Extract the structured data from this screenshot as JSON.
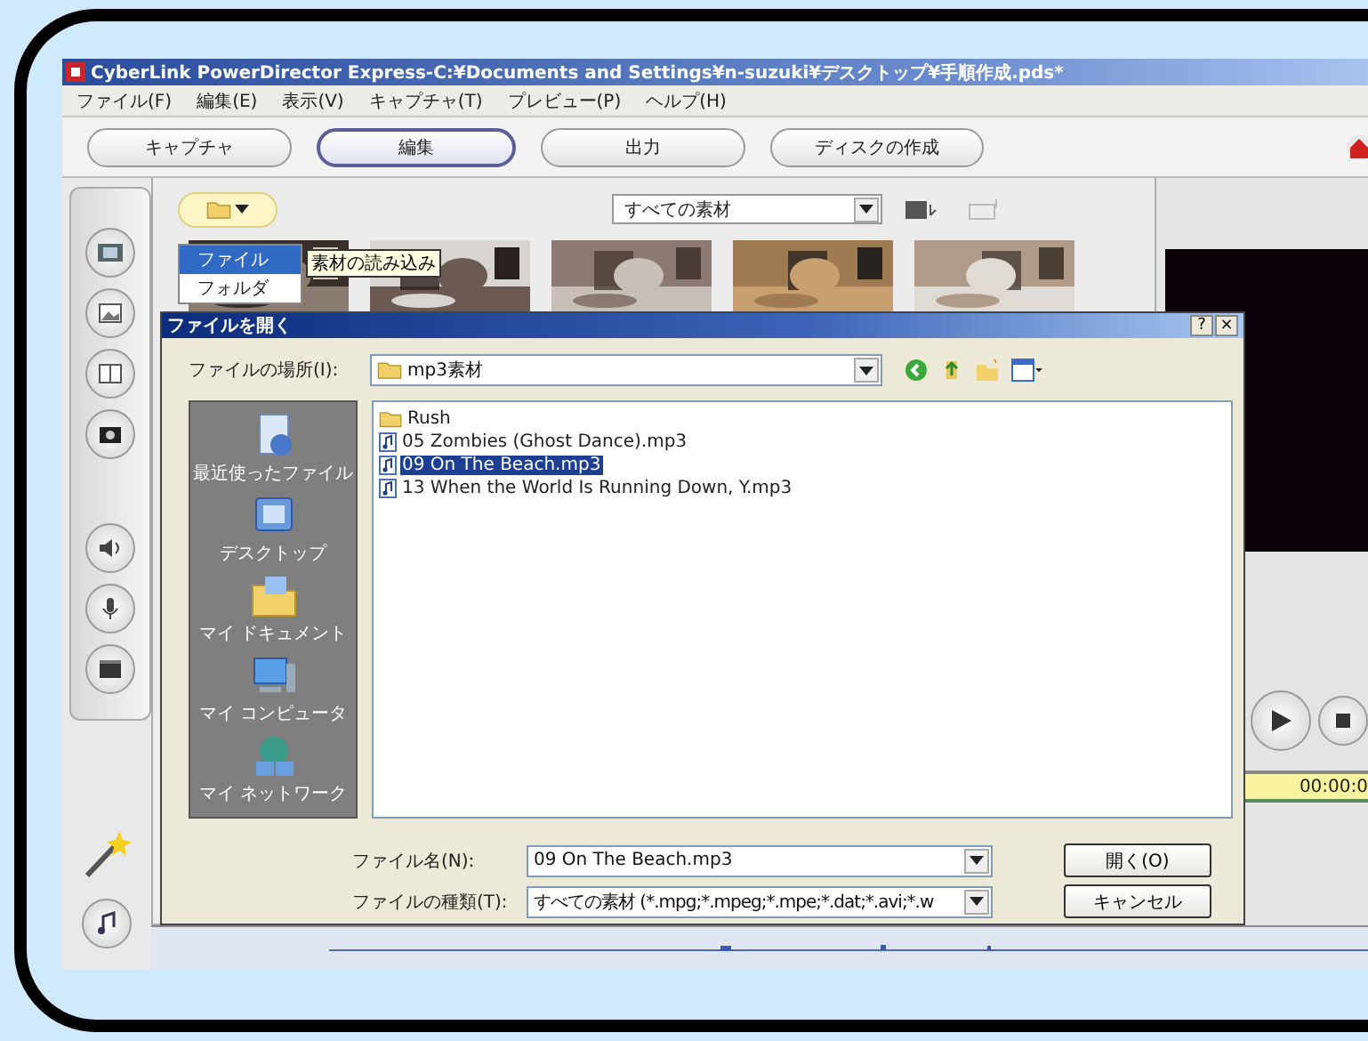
{
  "window": {
    "title": "CyberLink PowerDirector Express-C:¥Documents and Settings¥n-suzuki¥デスクトップ¥手順作成.pds*"
  },
  "menu": [
    "ファイル(F)",
    "編集(E)",
    "表示(V)",
    "キャプチャ(T)",
    "プレビュー(P)",
    "ヘルプ(H)"
  ],
  "mode_tabs": [
    {
      "label": "キャプチャ",
      "selected": false
    },
    {
      "label": "編集",
      "selected": true
    },
    {
      "label": "出力",
      "selected": false
    },
    {
      "label": "ディスクの作成",
      "selected": false
    }
  ],
  "library": {
    "import_menu": [
      {
        "label": "ファイル",
        "selected": true
      },
      {
        "label": "フォルダ",
        "selected": false
      }
    ],
    "tooltip": "素材の読み込み",
    "filter": "すべての素材"
  },
  "preview": {
    "timecode": "00:00:0"
  },
  "dialog": {
    "title": "ファイルを開く",
    "help": "?",
    "close": "×",
    "location_label": "ファイルの場所(I):",
    "location": "mp3素材",
    "places": [
      "最近使ったファイル",
      "デスクトップ",
      "マイ ドキュメント",
      "マイ コンピュータ",
      "マイ ネットワーク"
    ],
    "files": [
      {
        "kind": "folder",
        "name": "Rush",
        "selected": false
      },
      {
        "kind": "audio",
        "name": "05 Zombies (Ghost Dance).mp3",
        "selected": false
      },
      {
        "kind": "audio",
        "name": "09 On The Beach.mp3",
        "selected": true
      },
      {
        "kind": "audio",
        "name": "13 When the World Is Running Down, Y.mp3",
        "selected": false
      }
    ],
    "filename_label": "ファイル名(N):",
    "filename": "09 On The Beach.mp3",
    "filetype_label": "ファイルの種類(T):",
    "filetype": "すべての素材 (*.mpg;*.mpeg;*.mpe;*.dat;*.avi;*.w",
    "open_button": "開く(O)",
    "cancel_button": "キャンセル"
  }
}
